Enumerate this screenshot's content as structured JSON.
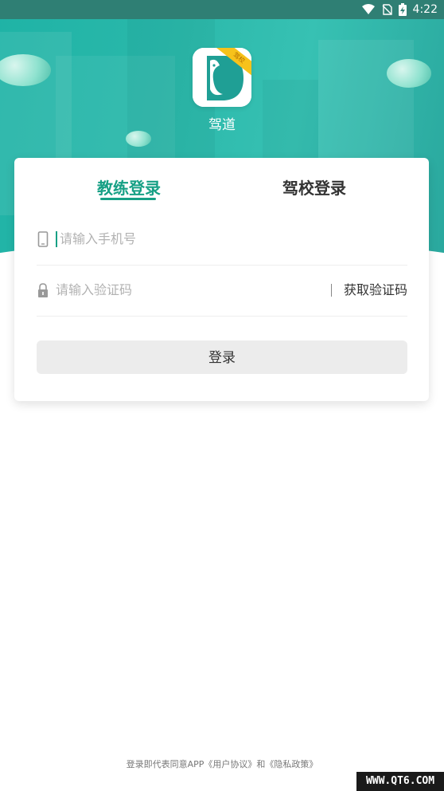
{
  "status_bar": {
    "time": "4:22"
  },
  "app": {
    "name": "驾道",
    "logo_badge": "驾校"
  },
  "tabs": [
    {
      "label": "教练登录",
      "active": true
    },
    {
      "label": "驾校登录",
      "active": false
    }
  ],
  "form": {
    "phone_placeholder": "请输入手机号",
    "code_placeholder": "请输入验证码",
    "get_code_label": "获取验证码",
    "login_label": "登录"
  },
  "footer": {
    "agreement": "登录即代表同意APP《用户协议》和《隐私政策》"
  },
  "watermark": "WWW.QT6.COM",
  "colors": {
    "accent": "#16a085",
    "header": "#2ab8aa",
    "button_bg": "#ececec"
  }
}
